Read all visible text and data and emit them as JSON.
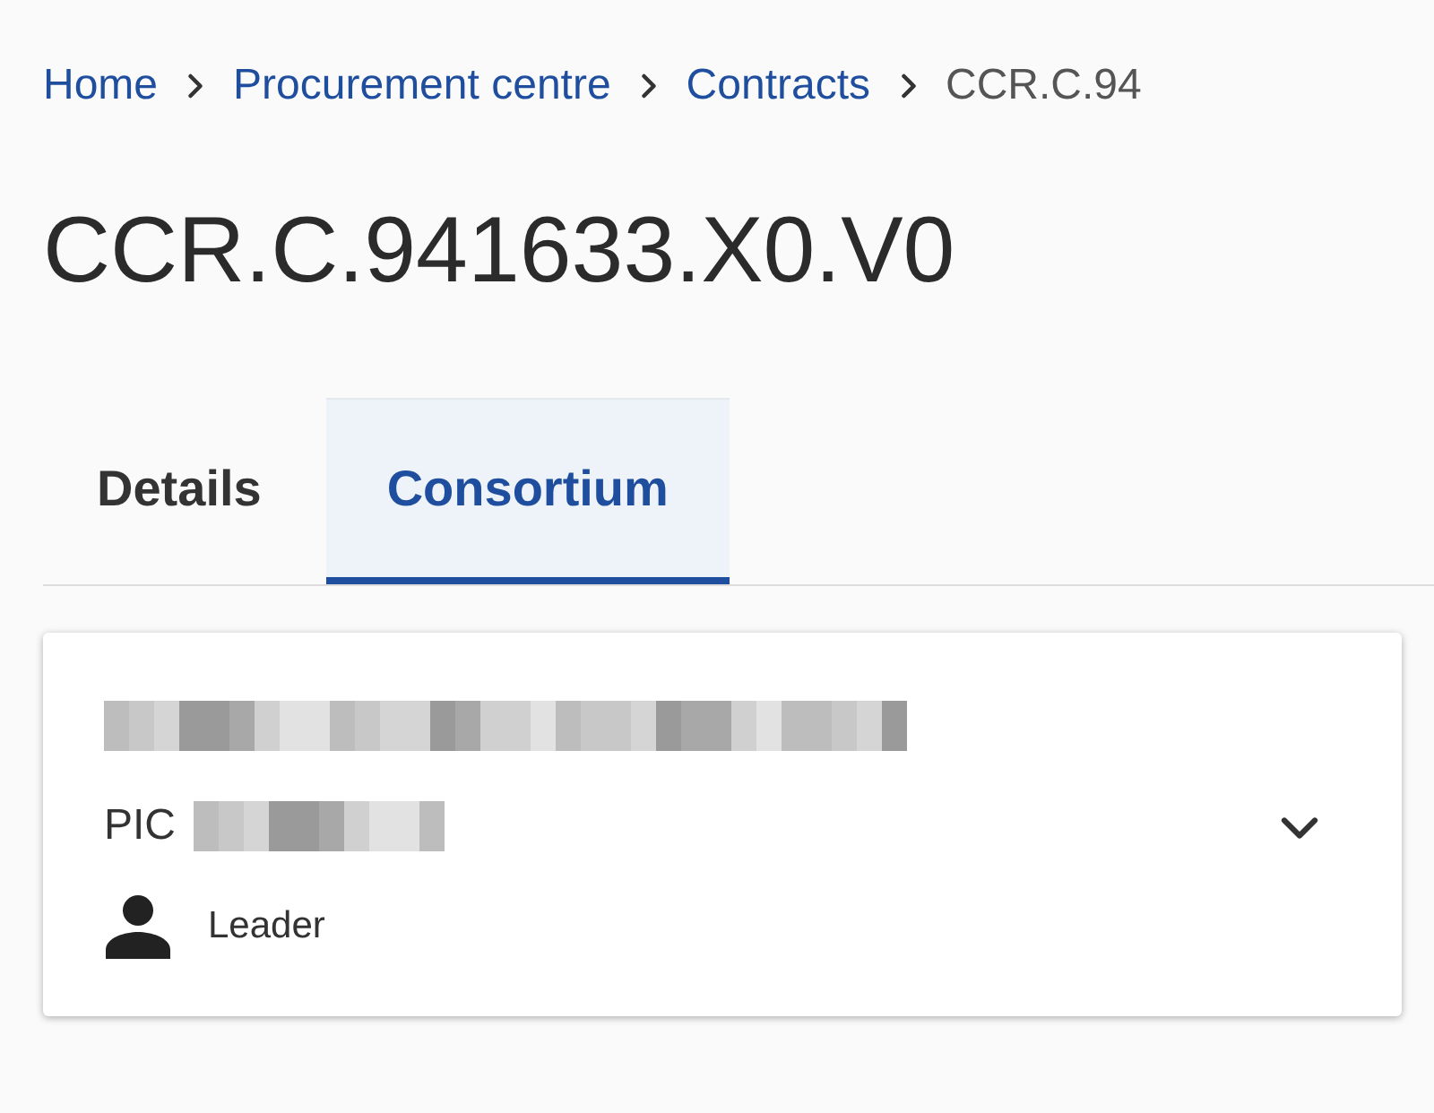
{
  "breadcrumb": [
    {
      "label": "Home",
      "link": true
    },
    {
      "label": "Procurement centre",
      "link": true
    },
    {
      "label": "Contracts",
      "link": true
    },
    {
      "label": "CCR.C.94",
      "link": false
    }
  ],
  "title": "CCR.C.941633.X0.V0",
  "tabs": [
    {
      "label": "Details",
      "selected": false
    },
    {
      "label": "Consortium",
      "selected": true
    }
  ],
  "members": [
    {
      "pic_label": "PIC",
      "role": "Leader",
      "expanded": false
    }
  ]
}
